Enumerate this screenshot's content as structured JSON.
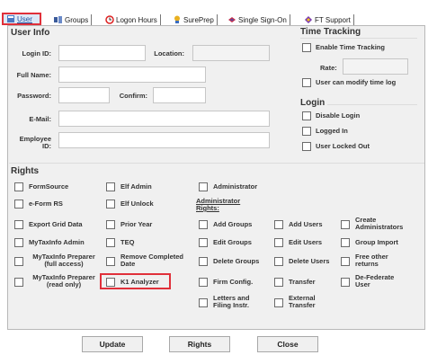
{
  "tabs": [
    {
      "label": "User",
      "icon": "user-tab-icon",
      "selected": true
    },
    {
      "label": "Groups",
      "icon": "groups-icon"
    },
    {
      "label": "Logon Hours",
      "icon": "clock-icon"
    },
    {
      "label": "SurePrep",
      "icon": "sureprep-icon"
    },
    {
      "label": "Single Sign-On",
      "icon": "sign-on-icon"
    },
    {
      "label": "FT Support",
      "icon": "support-icon"
    }
  ],
  "user_info": {
    "title": "User Info",
    "login_id_label": "Login ID:",
    "location_label": "Location:",
    "full_name_label": "Full Name:",
    "password_label": "Password:",
    "confirm_label": "Confirm:",
    "email_label": "E-Mail:",
    "employee_id_label_line1": "Employee",
    "employee_id_label_line2": "ID:"
  },
  "time_tracking": {
    "title": "Time Tracking",
    "enable_label": "Enable Time Tracking",
    "rate_label": "Rate:",
    "modify_label": "User can modify time log"
  },
  "login": {
    "title": "Login",
    "disable_label": "Disable Login",
    "logged_in_label": "Logged In",
    "locked_out_label": "User Locked Out"
  },
  "rights": {
    "title": "Rights",
    "admin_rights_label_line1": "Administrator",
    "admin_rights_label_line2": "Rights:",
    "items": {
      "formsource": "FormSource",
      "eform_rs": "e-Form RS",
      "export_grid": "Export Grid Data",
      "mytaxinfo_admin": "MyTaxInfo Admin",
      "mytaxinfo_prep_full_1": "MyTaxInfo Preparer",
      "mytaxinfo_prep_full_2": "(full access)",
      "mytaxinfo_prep_read_1": "MyTaxInfo Preparer",
      "mytaxinfo_prep_read_2": "(read only)",
      "elf_admin": "Elf Admin",
      "elf_unlock": "Elf Unlock",
      "prior_year": "Prior Year",
      "teq": "TEQ",
      "remove_completed_1": "Remove Completed",
      "remove_completed_2": "Date",
      "k1_analyzer": "K1 Analyzer",
      "administrator": "Administrator",
      "add_groups": "Add Groups",
      "edit_groups": "Edit Groups",
      "delete_groups": "Delete Groups",
      "firm_config": "Firm Config.",
      "letters_1": "Letters and",
      "letters_2": "Filing Instr.",
      "add_users": "Add Users",
      "edit_users": "Edit Users",
      "delete_users": "Delete Users",
      "transfer": "Transfer",
      "external_transfer_1": "External",
      "external_transfer_2": "Transfer",
      "create_admins_1": "Create",
      "create_admins_2": "Administrators",
      "group_import": "Group Import",
      "free_returns_1": "Free other",
      "free_returns_2": "returns",
      "defederate_1": "De-Federate",
      "defederate_2": "User"
    }
  },
  "buttons": {
    "update": "Update",
    "rights": "Rights",
    "close": "Close"
  }
}
